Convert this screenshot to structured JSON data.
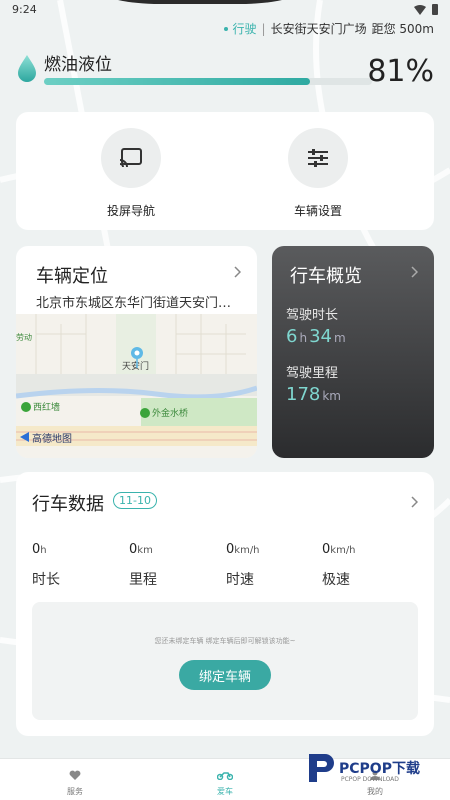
{
  "status_bar": {
    "time": "9:24"
  },
  "trip": {
    "state": "行驶",
    "separator": "|",
    "location": "长安街天安门广场",
    "distance": "距您 500m"
  },
  "fuel": {
    "label": "燃油液位",
    "percent_text": "81%",
    "level": 0.81,
    "accent": "#3ab3ad"
  },
  "actions": [
    {
      "label": "投屏导航",
      "icon": "cast-icon"
    },
    {
      "label": "车辆设置",
      "icon": "settings-sliders-icon"
    }
  ],
  "location_card": {
    "title": "车辆定位",
    "address": "北京市东城区东华门街道天安门…",
    "map": {
      "labels": {
        "poi_center": "天安门",
        "poi_left_top": "劳动",
        "poi_left": "西红墙",
        "poi_bottom": "外金水桥",
        "map_brand": "高德地图"
      }
    }
  },
  "overview_card": {
    "title": "行车概览",
    "duration_label": "驾驶时长",
    "duration_hours": "6",
    "hours_unit": "h",
    "duration_minutes": "34",
    "minutes_unit": "m",
    "mileage_label": "驾驶里程",
    "mileage_value": "178",
    "mileage_unit": "km"
  },
  "drive_data": {
    "title": "行车数据",
    "date": "11-10",
    "stats": [
      {
        "value": "0",
        "unit": "h",
        "label": "时长"
      },
      {
        "value": "0",
        "unit": "km",
        "label": "里程"
      },
      {
        "value": "0",
        "unit": "km/h",
        "label": "时速"
      },
      {
        "value": "0",
        "unit": "km/h",
        "label": "极速"
      }
    ],
    "bind_hint": "您还未绑定车辆 绑定车辆后即可解锁该功能~",
    "bind_button": "绑定车辆"
  },
  "tabs": [
    {
      "label": "服务",
      "active": false
    },
    {
      "label": "爱车",
      "active": true
    },
    {
      "label": "我的",
      "active": false
    }
  ],
  "watermark": {
    "text": "PCPOP下载",
    "sub": "PCPOP DOWNLOAD"
  }
}
